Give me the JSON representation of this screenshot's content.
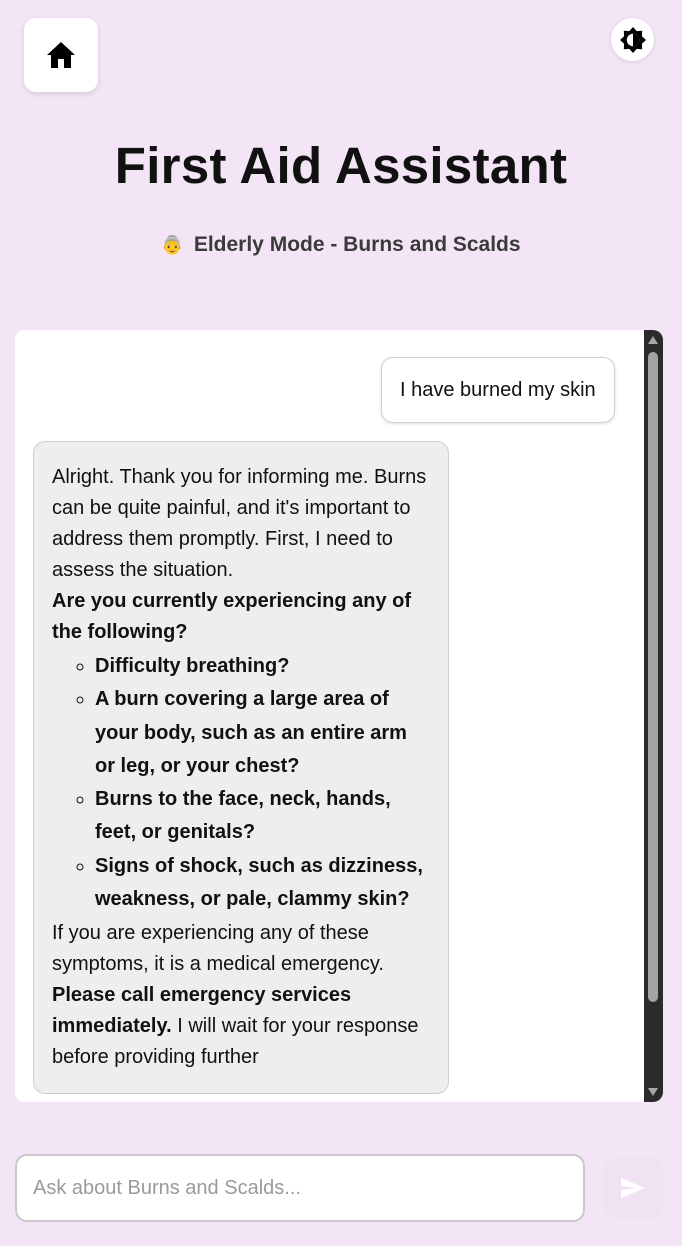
{
  "header": {
    "title": "First Aid Assistant",
    "mode_icon": "👵",
    "subtitle": "Elderly Mode - Burns and Scalds"
  },
  "icons": {
    "home": "home-icon",
    "theme": "brightness-icon",
    "send": "send-icon"
  },
  "messages": {
    "user": {
      "text": "I have burned my skin"
    },
    "bot": {
      "intro": "Alright. Thank you for informing me. Burns can be quite painful, and it's important to address them promptly. First, I need to assess the situation.",
      "question": "Are you currently experiencing any of the following?",
      "items": [
        "Difficulty breathing?",
        "A burn covering a large area of your body, such as an entire arm or leg, or your chest?",
        "Burns to the face, neck, hands, feet, or genitals?",
        "Signs of shock, such as dizziness, weakness, or pale, clammy skin?"
      ],
      "emergency_text": "If you are experiencing any of these symptoms, it is a medical emergency.",
      "emergency_bold": "Please call emergency services immediately.",
      "closing": "I will wait for your response before providing further"
    }
  },
  "composer": {
    "placeholder": "Ask about Burns and Scalds...",
    "value": ""
  },
  "colors": {
    "background": "#f3e5f5",
    "bot_bubble": "#eeeeee",
    "send_button": "#f0e2f2"
  }
}
